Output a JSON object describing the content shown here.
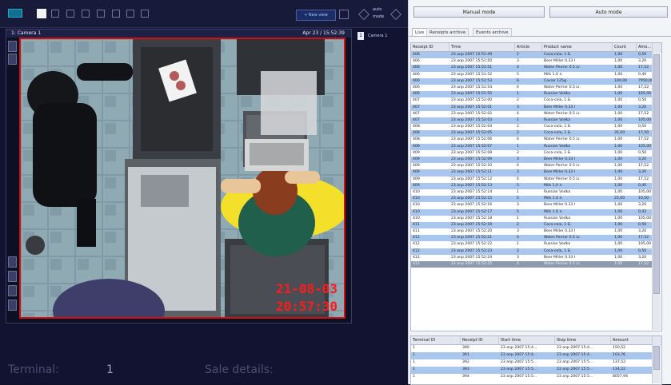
{
  "toolbar": {
    "new_view_label": "+ New view",
    "icons": [
      "layout-1-icon",
      "layout-4-icon",
      "layout-9-icon",
      "layout-16-icon",
      "layout-custom-a-icon",
      "layout-custom-b-icon",
      "layout-custom-c-icon"
    ],
    "side_labels": {
      "top": "auto",
      "bottom": "mode"
    }
  },
  "camera": {
    "title": "1: Camera 1",
    "timestamp": "Apr 23 / 15:52:39",
    "osd_date": "21-08-03",
    "osd_time": "20:57:30",
    "tab_number": "1",
    "tab_label": "Camera 1"
  },
  "footer": {
    "terminal_label": "Terminal:",
    "terminal_value": "1",
    "sale_details_label": "Sale details:"
  },
  "right_panel": {
    "manual_mode_label": "Manual mode",
    "auto_mode_label": "Auto mode",
    "tabs": [
      "Live",
      "Receipts archive",
      "Events archive"
    ],
    "receipts_headers": [
      "Receipt ID",
      "Time",
      "Article",
      "Product name",
      "Count",
      "Amo..."
    ],
    "receipts_rows": [
      [
        "406",
        "23 anp 2007 15:51:49",
        "2",
        "Coca-cola, 1 Б.",
        "1,00",
        "0,50"
      ],
      [
        "406",
        "23 anp 2007 15:51:50",
        "3",
        "Beer Miller 0.33 l",
        "1,00",
        "3,20"
      ],
      [
        "406",
        "23 anp 2007 15:51:51",
        "4",
        "Water Perrier 0.5 Lr.",
        "1,00",
        "17,52"
      ],
      [
        "406",
        "23 anp 2007 15:51:52",
        "5",
        "Milk 1.0 л.",
        "1,00",
        "0,40"
      ],
      [
        "406",
        "23 anp 2007 15:51:53",
        "6",
        "Caviar 125g.",
        "100,00",
        "7950,00"
      ],
      [
        "406",
        "23 anp 2007 15:51:54",
        "4",
        "Water Perrier 0.5 Lr.",
        "1,00",
        "17,52"
      ],
      [
        "406",
        "23 anp 2007 15:51:55",
        "1",
        "Russian Vodka",
        "1,00",
        "105,00"
      ],
      [
        "407",
        "23 anp 2007 15:52:00",
        "2",
        "Coca-cola, 1 Б.",
        "1,00",
        "0,50"
      ],
      [
        "407",
        "23 anp 2007 15:52:01",
        "3",
        "Beer Miller 0.33 l",
        "1,00",
        "3,20"
      ],
      [
        "407",
        "23 anp 2007 15:52:02",
        "4",
        "Water Perrier 0.5 Lr.",
        "1,00",
        "17,52"
      ],
      [
        "407",
        "23 anp 2007 15:52:03",
        "1",
        "Russian Vodka",
        "1,00",
        "105,00"
      ],
      [
        "408",
        "23 anp 2007 15:52:04",
        "2",
        "Coca-cola, 1 Б.",
        "1,00",
        "0,50"
      ],
      [
        "408",
        "23 anp 2007 15:52:05",
        "2",
        "Coca-cola, 1 Б.",
        "35,00",
        "17,50"
      ],
      [
        "408",
        "23 anp 2007 15:52:06",
        "4",
        "Water Perrier 0.5 Lr.",
        "1,00",
        "17,52"
      ],
      [
        "408",
        "23 anp 2007 15:52:07",
        "1",
        "Russian Vodka",
        "1,00",
        "105,00"
      ],
      [
        "409",
        "23 anp 2007 15:52:08",
        "2",
        "Coca-cola, 1 Б.",
        "1,00",
        "0,50"
      ],
      [
        "409",
        "23 anp 2007 15:52:09",
        "3",
        "Beer Miller 0.33 l",
        "1,00",
        "3,20"
      ],
      [
        "409",
        "23 anp 2007 15:52:10",
        "4",
        "Water Perrier 0.5 Lr.",
        "1,00",
        "17,52"
      ],
      [
        "409",
        "23 anp 2007 15:52:11",
        "3",
        "Beer Miller 0.33 l",
        "1,00",
        "3,20"
      ],
      [
        "409",
        "23 anp 2007 15:52:12",
        "4",
        "Water Perrier 0.5 Lr.",
        "1,00",
        "17,52"
      ],
      [
        "409",
        "23 anp 2007 15:52:13",
        "5",
        "Milk 1.0 л.",
        "1,00",
        "0,40"
      ],
      [
        "410",
        "23 anp 2007 15:52:14",
        "1",
        "Russian Vodka",
        "1,00",
        "105,00"
      ],
      [
        "410",
        "23 anp 2007 15:52:15",
        "5",
        "Milk 1.0 л.",
        "25,00",
        "10,50"
      ],
      [
        "410",
        "23 anp 2007 15:52:16",
        "3",
        "Beer Miller 0.33 l",
        "1,00",
        "3,20"
      ],
      [
        "410",
        "23 anp 2007 15:52:17",
        "5",
        "Milk 1.0 л.",
        "1,00",
        "0,42"
      ],
      [
        "410",
        "23 anp 2007 15:52:18",
        "1",
        "Russian Vodka",
        "1,00",
        "105,00"
      ],
      [
        "411",
        "23 anp 2007 15:52:19",
        "2",
        "Coca-cola, 1 Б.",
        "1,00",
        "0,50"
      ],
      [
        "411",
        "23 anp 2007 15:52:20",
        "3",
        "Beer Miller 0.33 l",
        "1,00",
        "3,20"
      ],
      [
        "411",
        "23 anp 2007 15:52:21",
        "4",
        "Water Perrier 0.5 Lr.",
        "1,00",
        "17,52"
      ],
      [
        "412",
        "23 anp 2007 15:52:22",
        "1",
        "Russian Vodka",
        "1,00",
        "105,00"
      ],
      [
        "412",
        "23 anp 2007 15:52:23",
        "2",
        "Coca-cola, 1 Б.",
        "1,00",
        "0,50"
      ],
      [
        "412",
        "23 anp 2007 15:52:24",
        "3",
        "Beer Miller 0.33 l",
        "1,00",
        "3,20"
      ],
      [
        "412",
        "23 anp 2007 15:52:25",
        "4",
        "Water Perrier 0.5 Lr.",
        "1,00",
        "17,52"
      ]
    ],
    "receipts_highlight": [
      0,
      2,
      4,
      6,
      8,
      10,
      12,
      14,
      16,
      18,
      20,
      22,
      24,
      26,
      28,
      30
    ],
    "receipts_selected": 32,
    "sales_headers": [
      "Terminal ID",
      "Receipt ID",
      "Start time",
      "Stop time",
      "Amount"
    ],
    "sales_rows": [
      [
        "1",
        "390",
        "23 anp 2007 15:4...",
        "23 anp 2007 15:4...",
        "150,52"
      ],
      [
        "1",
        "391",
        "23 anp 2007 15:4...",
        "23 anp 2007 15:4...",
        "103,76"
      ],
      [
        "1",
        "392",
        "23 anp 2007 15:5...",
        "23 anp 2007 15:5...",
        "137,52"
      ],
      [
        "1",
        "393",
        "23 anp 2007 15:5...",
        "23 anp 2007 15:5...",
        "134,22"
      ],
      [
        "1",
        "394",
        "23 anp 2007 15:5...",
        "23 anp 2007 15:5...",
        "8057,94"
      ]
    ],
    "sales_highlight": [
      1,
      3
    ],
    "colors": {
      "row_highlight": "#a9c6ee",
      "row_selected": "#8f9aae",
      "osd": "#ff1b1b",
      "video_border": "#d01010"
    }
  }
}
